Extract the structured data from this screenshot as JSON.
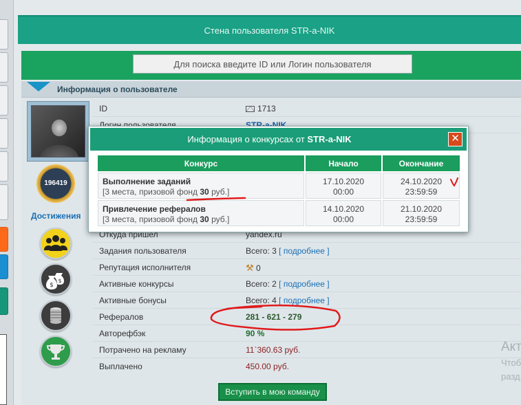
{
  "page": {
    "banner_title": "Стена пользователя STR-a-NIK",
    "search_placeholder": "Для поиска введите ID или Логин пользователя",
    "info_header": "Информация о пользователе"
  },
  "profile": {
    "badge_number": "196419",
    "achievements_label": "Достижения",
    "achievement_icons": [
      "users-icon",
      "money-bags-icon",
      "coins-icon",
      "trophy-icon"
    ]
  },
  "rows": [
    {
      "label": "ID",
      "value": "1713",
      "icon": "envelope-icon"
    },
    {
      "label": "Логин пользователя",
      "value": "STR-a-NIK"
    },
    {
      "label": "Откуда пришел",
      "value": "yandex.ru"
    },
    {
      "label": "Задания пользователя",
      "value": "Всего: 3",
      "link": "[ подробнее ]"
    },
    {
      "label": "Репутация исполнителя",
      "value": "0",
      "icon": "tools-icon"
    },
    {
      "label": "Активные конкурсы",
      "value": "Всего: 2",
      "link": "[ подробнее ]"
    },
    {
      "label": "Активные бонусы",
      "value": "Всего: 4",
      "link": "[ подробнее ]"
    },
    {
      "label": "Рефералов",
      "value": "281 - 621 - 279"
    },
    {
      "label": "Авторефбэк",
      "value": "90 %"
    },
    {
      "label": "Потрачено на рекламу",
      "value": "11`360.63 руб."
    },
    {
      "label": "Выплачено",
      "value": "450.00 руб."
    }
  ],
  "join_button": "Вступить в мою команду",
  "watermark": {
    "line1": "Акт",
    "line2": "Чтоб",
    "line3": "разд"
  },
  "modal": {
    "title_prefix": "Информация о конкурсах от",
    "title_user": "STR-a-NIK",
    "close": "✕",
    "columns": [
      "Конкурс",
      "Начало",
      "Окончание"
    ],
    "contests": [
      {
        "name": "Выполнение заданий",
        "details_prefix": "[3 места, призовой фонд",
        "fund": "30",
        "details_suffix": "руб.]",
        "start_date": "17.10.2020",
        "start_time": "00:00",
        "end_date": "24.10.2020",
        "end_time": "23:59:59"
      },
      {
        "name": "Привлечение рефералов",
        "details_prefix": "[3 места, призовой фонд",
        "fund": "30",
        "details_suffix": "руб.]",
        "start_date": "14.10.2020",
        "start_time": "00:00",
        "end_date": "21.10.2020",
        "end_time": "23:59:59"
      }
    ]
  },
  "colors": {
    "banner": "#1aa186",
    "search_band": "#1aa35f",
    "modal_header": "#1a9d78",
    "annotation": "#e0191b"
  }
}
